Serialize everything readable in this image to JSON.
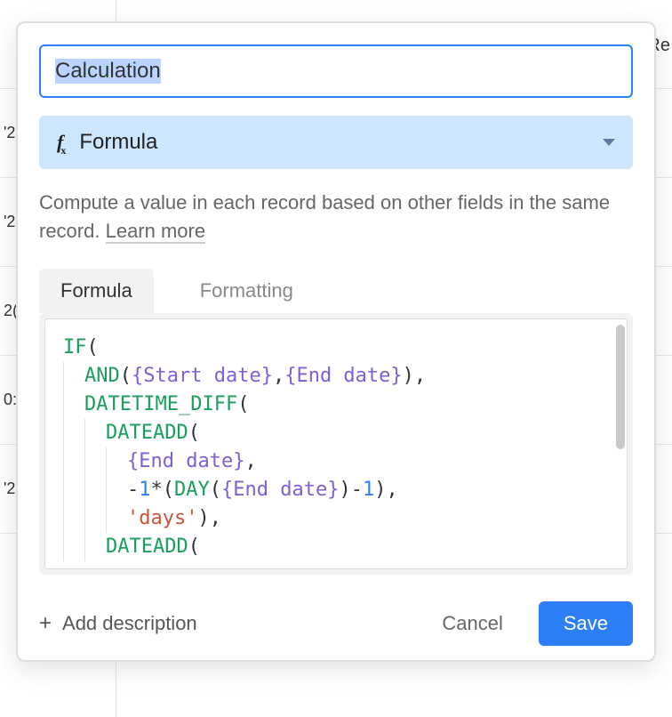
{
  "bg": {
    "row_labels": [
      "",
      "'2",
      "'2",
      "2(",
      "0:",
      "'2"
    ],
    "top_right": "Re"
  },
  "dialog": {
    "field_name": "Calculation",
    "type": {
      "icon": "fx-icon",
      "label": "Formula"
    },
    "description": "Compute a value in each record based on other fields in the same record. ",
    "learn_more": "Learn more",
    "tabs": [
      {
        "id": "formula",
        "label": "Formula",
        "active": true
      },
      {
        "id": "formatting",
        "label": "Formatting",
        "active": false
      }
    ],
    "formula_tokens": [
      [
        [
          "fn",
          "IF"
        ],
        [
          "punc",
          "("
        ]
      ],
      [
        [
          "indent",
          1
        ],
        [
          "fn",
          "AND"
        ],
        [
          "punc",
          "("
        ],
        [
          "field",
          "{Start date}"
        ],
        [
          "punc",
          ","
        ],
        [
          "field",
          "{End date}"
        ],
        [
          "punc",
          "),"
        ]
      ],
      [
        [
          "indent",
          1
        ],
        [
          "fn",
          "DATETIME_DIFF"
        ],
        [
          "punc",
          "("
        ]
      ],
      [
        [
          "indent",
          2
        ],
        [
          "fn",
          "DATEADD"
        ],
        [
          "punc",
          "("
        ]
      ],
      [
        [
          "indent",
          3
        ],
        [
          "field",
          "{End date}"
        ],
        [
          "punc",
          ","
        ]
      ],
      [
        [
          "indent",
          3
        ],
        [
          "op",
          "-"
        ],
        [
          "num",
          "1"
        ],
        [
          "op",
          "*"
        ],
        [
          "punc",
          "("
        ],
        [
          "fn",
          "DAY"
        ],
        [
          "punc",
          "("
        ],
        [
          "field",
          "{End date}"
        ],
        [
          "punc",
          ")"
        ],
        [
          "op",
          "-"
        ],
        [
          "num",
          "1"
        ],
        [
          "punc",
          "),"
        ]
      ],
      [
        [
          "indent",
          3
        ],
        [
          "str",
          "'days'"
        ],
        [
          "punc",
          "),"
        ]
      ],
      [
        [
          "indent",
          2
        ],
        [
          "fn",
          "DATEADD"
        ],
        [
          "punc",
          "("
        ]
      ]
    ],
    "footer": {
      "add_description": "Add description",
      "cancel": "Cancel",
      "save": "Save"
    }
  }
}
